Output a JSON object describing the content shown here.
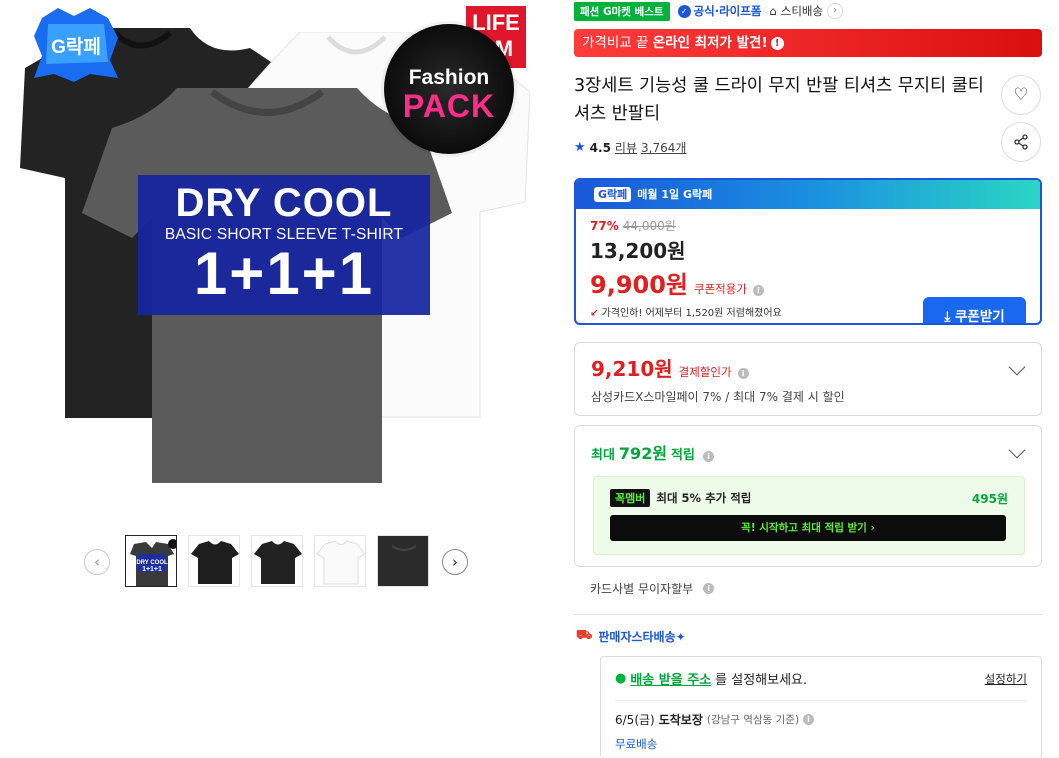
{
  "hero": {
    "badge_g": "G락페",
    "badge_life_line1": "LIFE",
    "badge_life_line2": "RM",
    "fashion_pack_line1": "Fashion",
    "fashion_pack_line2": "PACK",
    "banner_title": "DRY COOL",
    "banner_subtitle": "BASIC SHORT SLEEVE T-SHIRT",
    "banner_big": "1+1+1",
    "shirt_label": "DRY COOL"
  },
  "thumbnails": {
    "prev_icon": "chevron-left-icon",
    "next_icon": "chevron-right-icon",
    "prev_label": "‹",
    "next_label": "›",
    "items": [
      {
        "name": "thumb-1",
        "color": "#3a3a3a",
        "mini_text": "DRY COOL 1+1+1"
      },
      {
        "name": "thumb-2",
        "color": "#1e1e1e"
      },
      {
        "name": "thumb-3",
        "color": "#222222"
      },
      {
        "name": "thumb-4",
        "color": "#f6f6f6"
      },
      {
        "name": "thumb-5",
        "color": "#2b2b2b"
      }
    ]
  },
  "tags": {
    "fashion_best": "패션 G마켓 베스트",
    "official": "공식·라이프폼",
    "shop": "스티배송"
  },
  "lowest_bar": {
    "text_prefix": "가격비교 끝 ",
    "text_bold": "온라인 최저가 발견!",
    "info": "!"
  },
  "product": {
    "title": "3장세트 기능성 쿨 드라이 무지 반팔 티셔츠 무지티 쿨티셔츠 반팔티",
    "rating": "4.5",
    "review_label": "리뷰",
    "review_count": "3,764개"
  },
  "price_box": {
    "header_logo": "G락페",
    "header_text": "매월 1일 G락페",
    "discount_pct": "77%",
    "original_price": "44,000원",
    "sale_price": "13,200원",
    "coupon_price": "9,900원",
    "coupon_label": "쿠폰적용가",
    "drop_text": "가격인하! 어제부터 1,520원 저렴해졌어요",
    "coupon_button": "쿠폰받기",
    "accent": "#1a57d9"
  },
  "card_discount": {
    "price": "9,210원",
    "label": "결제할인가",
    "desc": "삼성카드X스마일페이 7% / 최대 7% 결제 시 할인"
  },
  "points": {
    "prefix": "최대",
    "amount": "792원",
    "suffix": "적립",
    "member_badge": "꼭멤버",
    "member_text": "최대 5% 추가 적립",
    "member_amount": "495원",
    "member_button": "꼭! 시작하고 최대 적립 받기 ›"
  },
  "installment": {
    "text": "카드사별 무이자할부"
  },
  "shipping": {
    "seller_label": "판매자스타배송✦",
    "addr_link": "배송 받을 주소",
    "addr_suffix": "를 설정해보세요.",
    "setting": "설정하기",
    "eta_date": "6/5(금)",
    "eta_label": "도착보장",
    "eta_area": "(강남구 역삼동 기준)",
    "free": "무료배송"
  }
}
